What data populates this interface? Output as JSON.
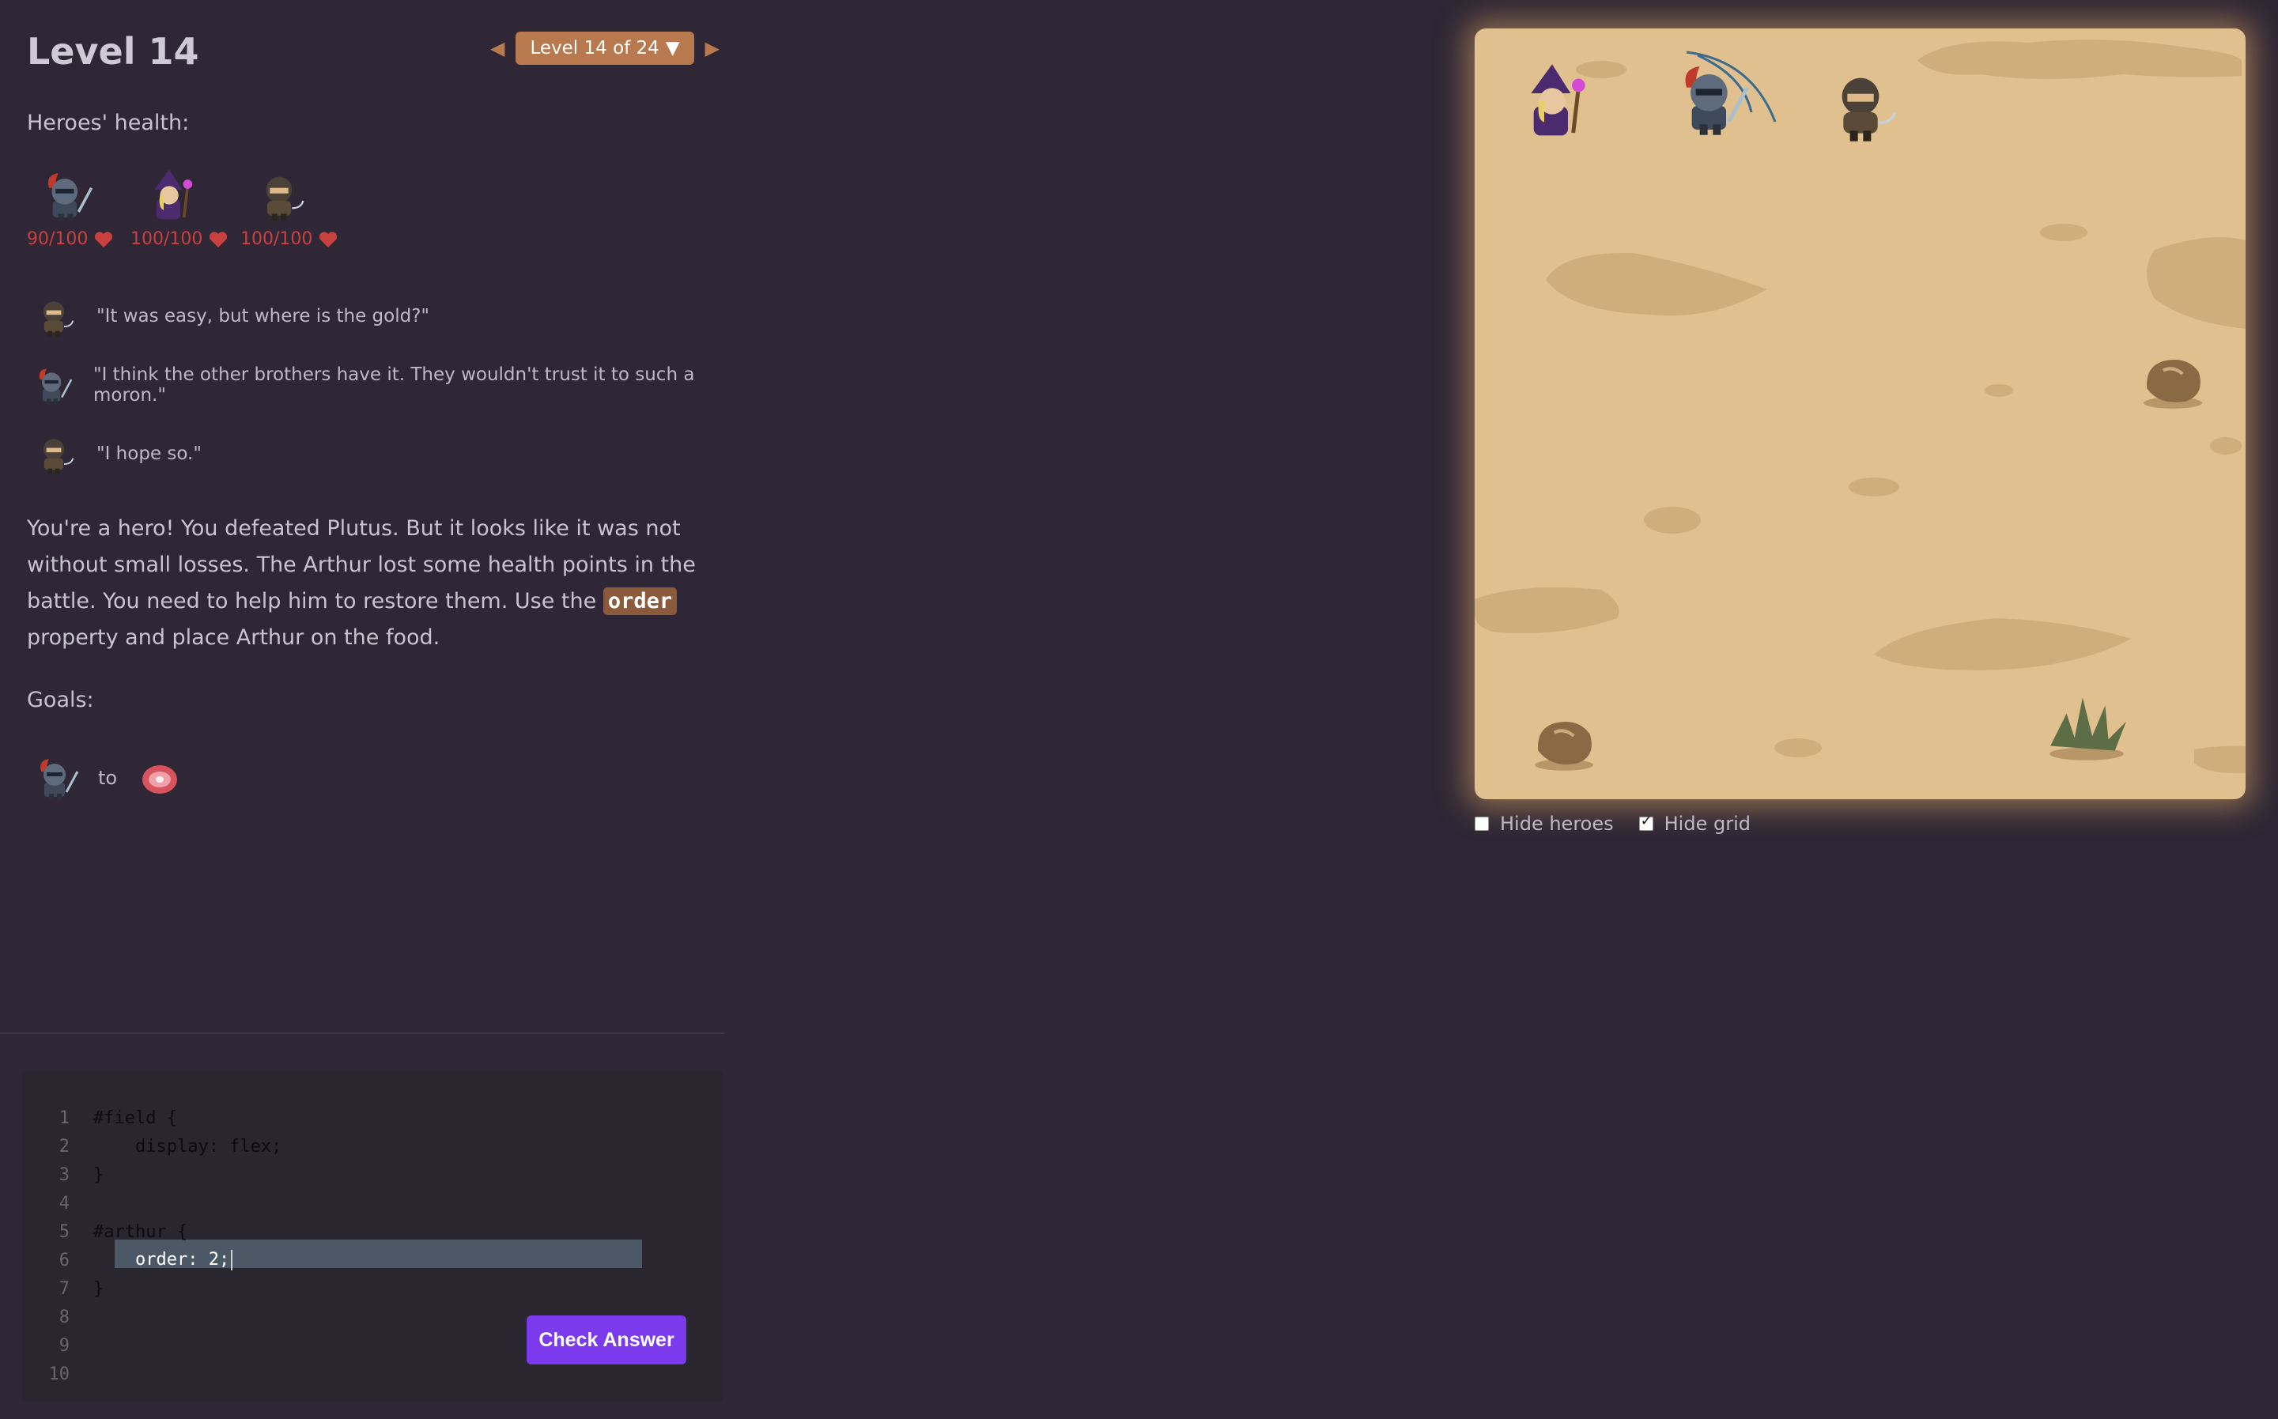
{
  "level": {
    "title": "Level 14",
    "selector_label": "Level 14 of 24",
    "prev_icon": "chevron-left-icon",
    "next_icon": "chevron-right-icon"
  },
  "health": {
    "label": "Heroes' health:",
    "heroes": [
      {
        "name": "knight",
        "hp": "90/100"
      },
      {
        "name": "wizard",
        "hp": "100/100"
      },
      {
        "name": "rogue",
        "hp": "100/100"
      }
    ]
  },
  "dialog": [
    {
      "speaker": "rogue",
      "text": "\"It was easy, but where is the gold?\""
    },
    {
      "speaker": "knight",
      "text": "\"I think the other brothers have it. They wouldn't trust it to such a moron.\""
    },
    {
      "speaker": "rogue",
      "text": "\"I hope so.\""
    }
  ],
  "description": {
    "part1": "You're a hero! You defeated Plutus. But it looks like it was not without small losses. The Arthur lost some health points in the battle. You need to help him to restore them. Use the",
    "code": "order",
    "part2": "property and place Arthur on the food."
  },
  "goals": {
    "label": "Goals:",
    "to": "to",
    "hero": "knight",
    "target": "meat"
  },
  "editor": {
    "lines": [
      {
        "n": "1",
        "code": "#field {"
      },
      {
        "n": "2",
        "code": "    display: flex;"
      },
      {
        "n": "3",
        "code": "}"
      },
      {
        "n": "4",
        "code": ""
      },
      {
        "n": "5",
        "code": "#arthur {"
      },
      {
        "n": "6",
        "code": "    order: 2;"
      },
      {
        "n": "7",
        "code": "}"
      },
      {
        "n": "8",
        "code": ""
      },
      {
        "n": "9",
        "code": ""
      },
      {
        "n": "10",
        "code": ""
      }
    ],
    "button": "Check Answer"
  },
  "board": {
    "items": [
      "wizard",
      "knight",
      "rogue",
      "rock",
      "rock",
      "bush"
    ]
  },
  "controls": {
    "hide_heroes": "Hide heroes",
    "hide_grid": "Hide grid",
    "hide_heroes_checked": false,
    "hide_grid_checked": true
  },
  "colors": {
    "background": "#2f2735",
    "accent": "#b8794e",
    "button": "#7c3aed",
    "health": "#c94040",
    "board": "#e0c08f"
  }
}
